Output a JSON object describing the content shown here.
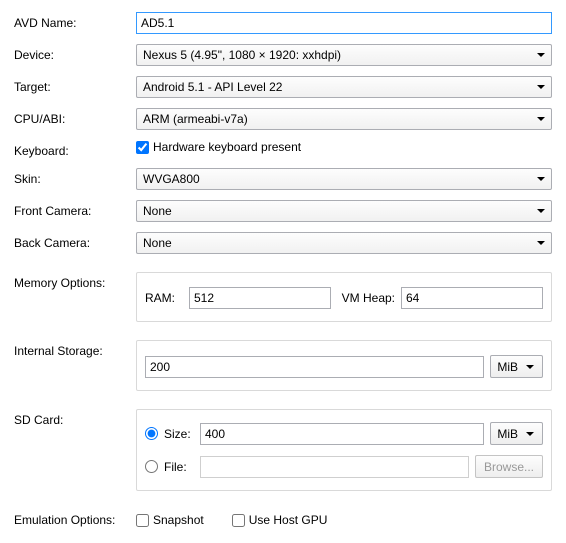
{
  "labels": {
    "avd_name": "AVD Name:",
    "device": "Device:",
    "target": "Target:",
    "cpu_abi": "CPU/ABI:",
    "keyboard": "Keyboard:",
    "skin": "Skin:",
    "front_camera": "Front Camera:",
    "back_camera": "Back Camera:",
    "memory_options": "Memory Options:",
    "internal_storage": "Internal Storage:",
    "sd_card": "SD Card:",
    "emulation_options": "Emulation Options:"
  },
  "values": {
    "avd_name": "AD5.1",
    "device": "Nexus 5 (4.95\", 1080 × 1920: xxhdpi)",
    "target": "Android 5.1 - API Level 22",
    "cpu_abi": "ARM (armeabi-v7a)",
    "skin": "WVGA800",
    "front_camera": "None",
    "back_camera": "None",
    "ram": "512",
    "vm_heap": "64",
    "internal_storage": "200",
    "sd_size": "400",
    "sd_file": ""
  },
  "sublabels": {
    "ram": "RAM:",
    "vm_heap": "VM Heap:",
    "size": "Size:",
    "file": "File:"
  },
  "options": {
    "hw_keyboard": "Hardware keyboard present",
    "snapshot": "Snapshot",
    "use_host_gpu": "Use Host GPU"
  },
  "units": {
    "mib": "MiB"
  },
  "buttons": {
    "browse": "Browse..."
  }
}
